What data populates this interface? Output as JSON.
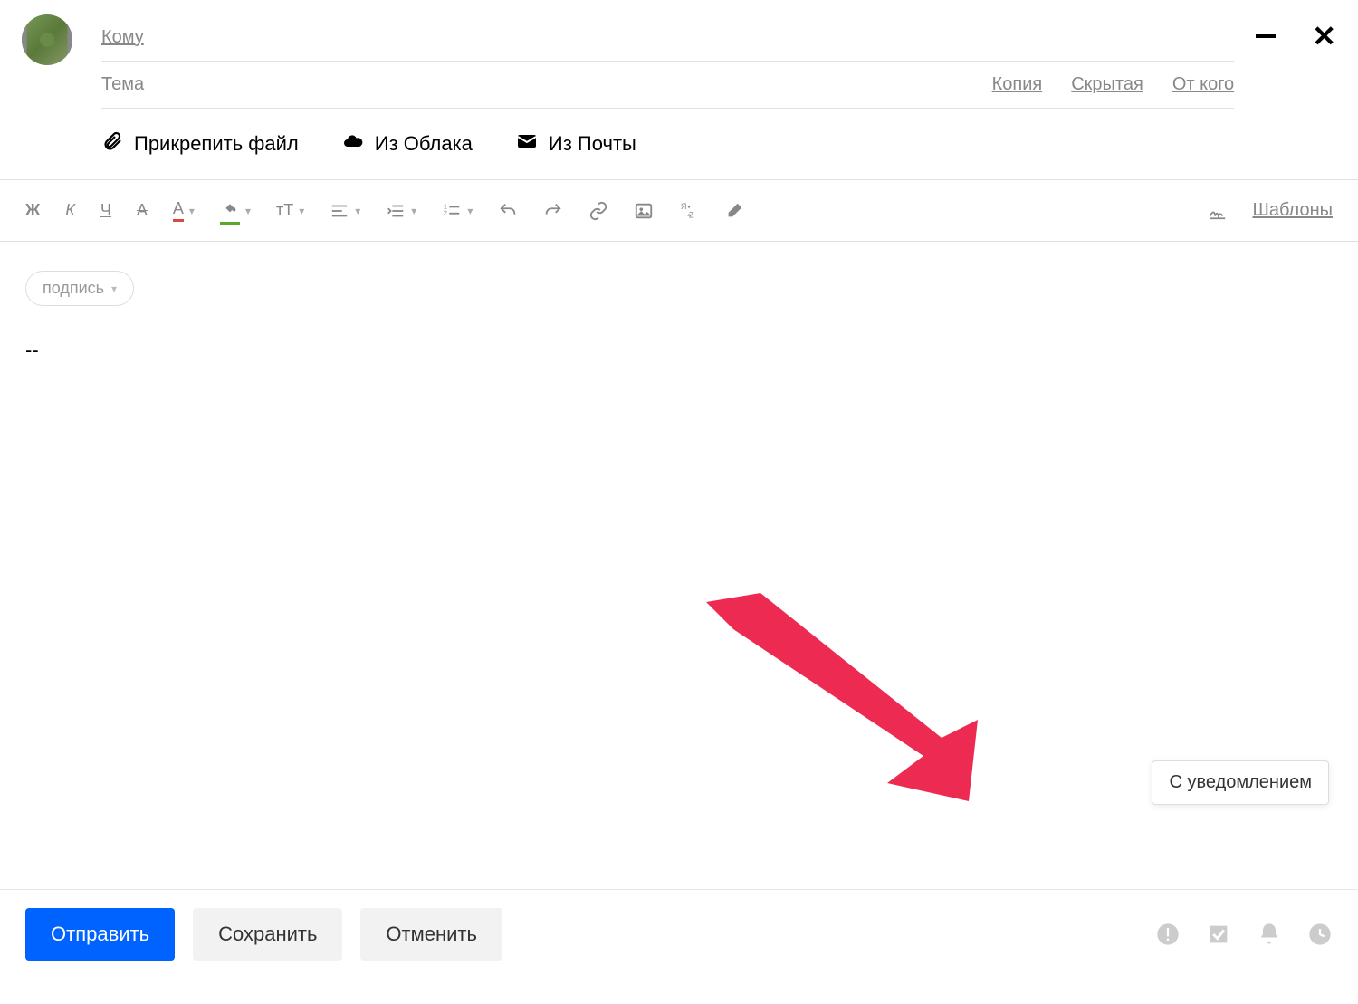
{
  "fields": {
    "to_label": "Кому",
    "subject_label": "Тема",
    "copy_link": "Копия",
    "bcc_link": "Скрытая",
    "from_link": "От кого"
  },
  "attach": {
    "file": "Прикрепить файл",
    "cloud": "Из Облака",
    "mail": "Из Почты"
  },
  "toolbar": {
    "bold": "Ж",
    "italic": "К",
    "underline": "Ч",
    "strike": "A",
    "font_color": "А",
    "font_size": "тТ",
    "templates": "Шаблоны"
  },
  "body": {
    "signature_label": "подпись",
    "signature_separator": "--"
  },
  "tooltip": {
    "text": "С уведомлением"
  },
  "footer": {
    "send": "Отправить",
    "save": "Сохранить",
    "cancel": "Отменить"
  }
}
